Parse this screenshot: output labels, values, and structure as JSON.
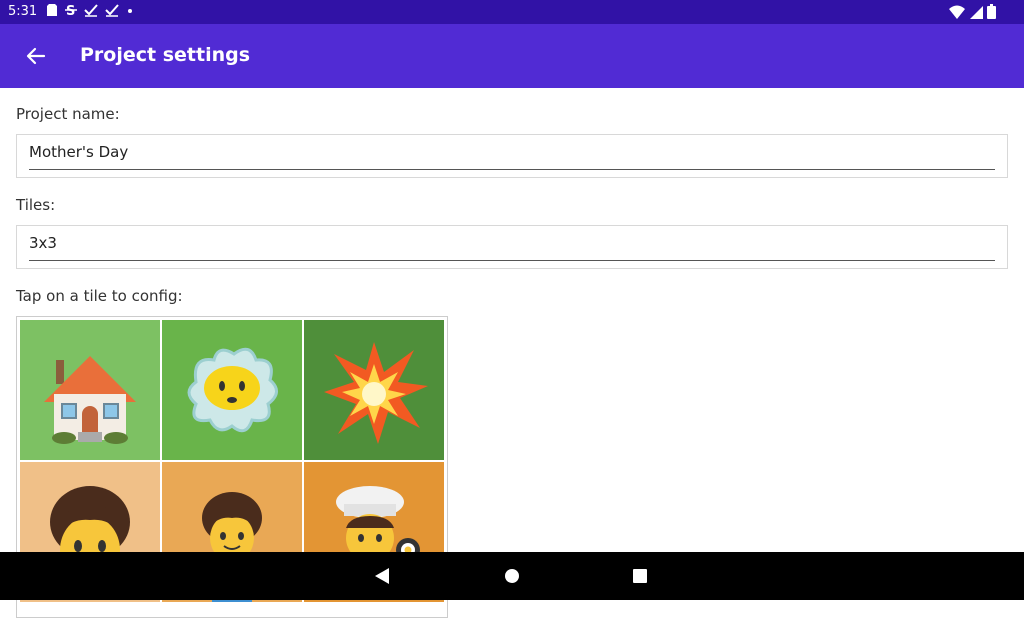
{
  "status_bar": {
    "time": "5:31",
    "icons": [
      "sim-card-icon",
      "s-app-icon",
      "check-icon",
      "check-icon",
      "dot-icon"
    ],
    "right_icons": [
      "wifi-icon",
      "signal-icon",
      "battery-icon"
    ]
  },
  "app_bar": {
    "title": "Project settings",
    "background": "#512bd4",
    "back_icon": "back-arrow-icon"
  },
  "form": {
    "project_name_label": "Project name:",
    "project_name_value": "Mother's Day",
    "tiles_label": "Tiles:",
    "tiles_value": "3x3",
    "grid_label": "Tap on a tile to config:"
  },
  "tiles": [
    {
      "icon": "house-icon",
      "color": "#7dc163"
    },
    {
      "icon": "exploding-face-icon",
      "color": "#69b44a"
    },
    {
      "icon": "collision-icon",
      "color": "#4f8f3a"
    },
    {
      "icon": "person-icon",
      "color": "#f0c088"
    },
    {
      "icon": "person-small-icon",
      "color": "#e9a855"
    },
    {
      "icon": "cook-icon",
      "color": "#e39534"
    }
  ],
  "nav_bar": {
    "icons": [
      "back-triangle-icon",
      "home-circle-icon",
      "recents-square-icon"
    ]
  }
}
